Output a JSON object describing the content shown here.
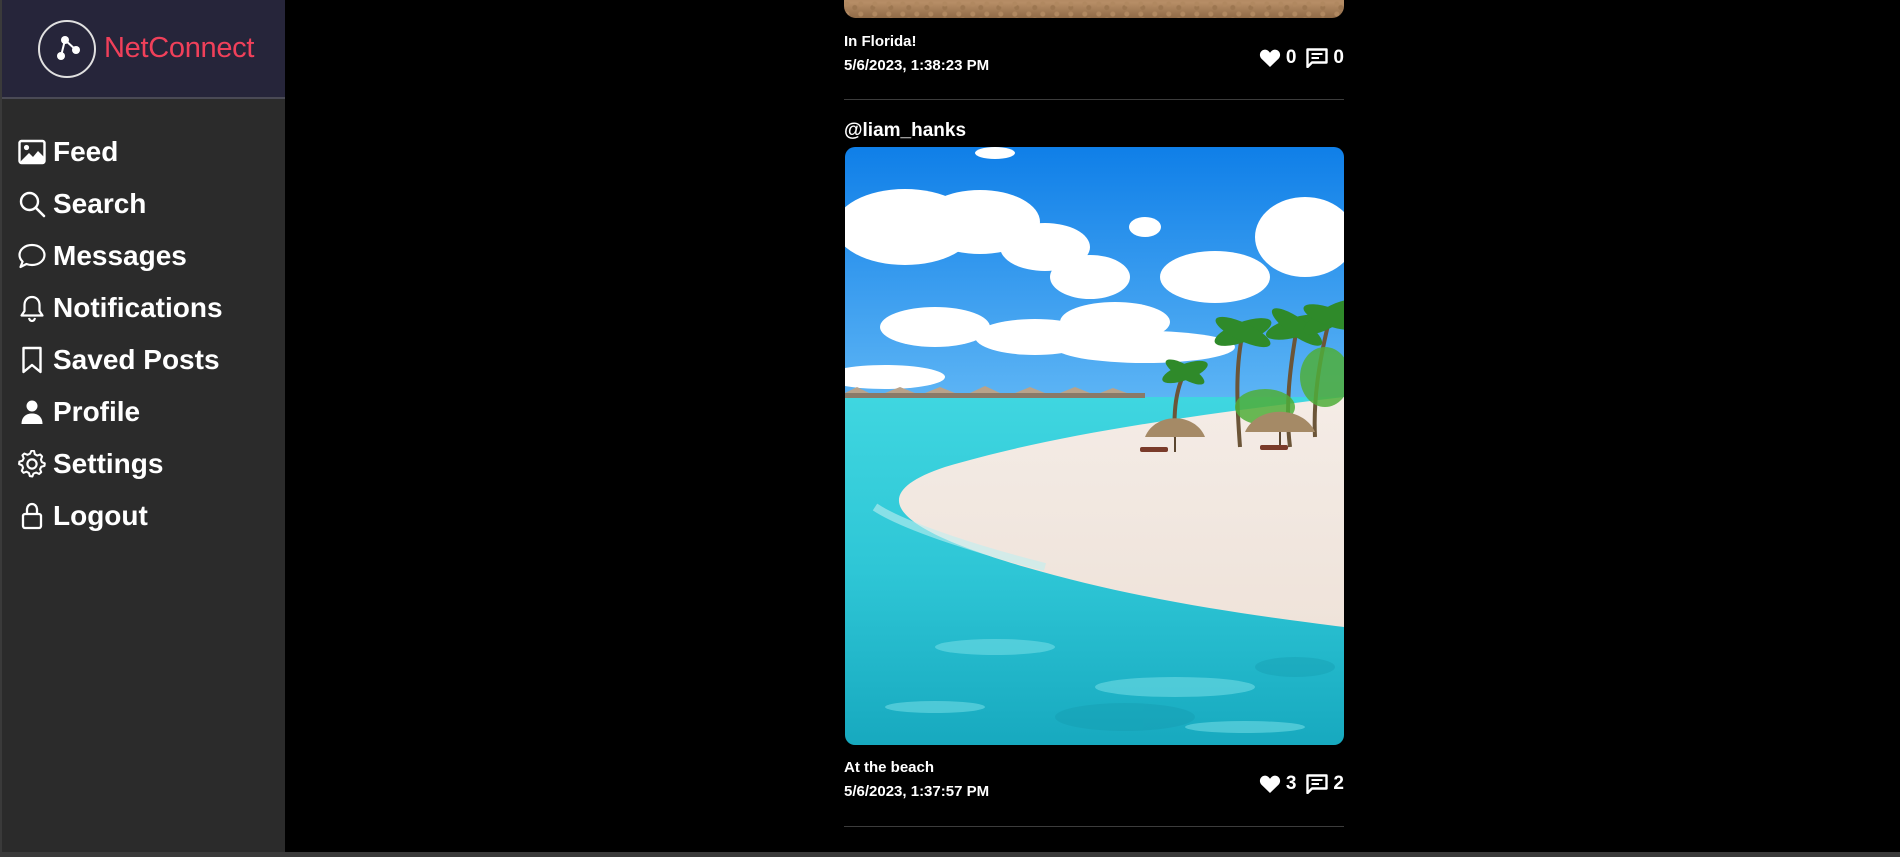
{
  "brand": {
    "name": "NetConnect"
  },
  "nav": [
    {
      "label": "Feed",
      "icon": "image-icon"
    },
    {
      "label": "Search",
      "icon": "search-icon"
    },
    {
      "label": "Messages",
      "icon": "chat-bubble-icon"
    },
    {
      "label": "Notifications",
      "icon": "bell-icon"
    },
    {
      "label": "Saved Posts",
      "icon": "bookmark-icon"
    },
    {
      "label": "Profile",
      "icon": "person-icon"
    },
    {
      "label": "Settings",
      "icon": "gear-icon"
    },
    {
      "label": "Logout",
      "icon": "lock-icon"
    }
  ],
  "posts": [
    {
      "caption": "In Florida!",
      "timestamp": "5/6/2023, 1:38:23 PM",
      "likes": "0",
      "comments": "0"
    },
    {
      "username": "@liam_hanks",
      "image": "beach-photo",
      "caption": "At the beach",
      "timestamp": "5/6/2023, 1:37:57 PM",
      "likes": "3",
      "comments": "2"
    }
  ],
  "colors": {
    "brand_accent": "#f0405a",
    "sidebar_bg": "#2b2b2b",
    "brand_bg": "#26253a",
    "page_bg": "#000000"
  }
}
